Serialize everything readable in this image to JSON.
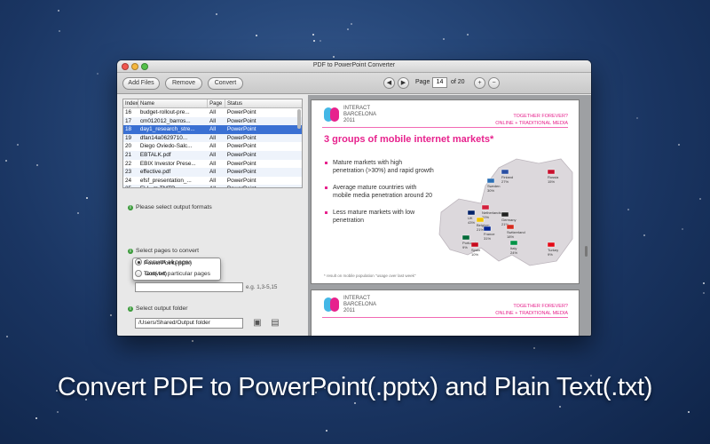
{
  "window": {
    "title": "PDF to PowerPoint Converter"
  },
  "toolbar": {
    "add_files": "Add Files",
    "remove": "Remove",
    "convert": "Convert",
    "page_label": "Page",
    "page_value": "14",
    "page_total": "of 20",
    "prev": "◀",
    "next": "▶",
    "zoom_in": "+",
    "zoom_out": "−"
  },
  "file_table": {
    "columns": [
      "Index",
      "Name",
      "Page",
      "Status"
    ],
    "rows": [
      {
        "index": "16",
        "name": "budget-rollout-pre...",
        "page": "All",
        "status": "PowerPoint"
      },
      {
        "index": "17",
        "name": "cm012012_barros...",
        "page": "All",
        "status": "PowerPoint"
      },
      {
        "index": "18",
        "name": "day1_research_stre...",
        "page": "All",
        "status": "PowerPoint"
      },
      {
        "index": "19",
        "name": "dfan14a0629710...",
        "page": "All",
        "status": "PowerPoint"
      },
      {
        "index": "20",
        "name": "Diego Oviedo-Salc...",
        "page": "All",
        "status": "PowerPoint"
      },
      {
        "index": "21",
        "name": "EBTALK.pdf",
        "page": "All",
        "status": "PowerPoint"
      },
      {
        "index": "22",
        "name": "EBIX Investor Prese...",
        "page": "All",
        "status": "PowerPoint"
      },
      {
        "index": "23",
        "name": "effective.pdf",
        "page": "All",
        "status": "PowerPoint"
      },
      {
        "index": "24",
        "name": "efsf_presentation_...",
        "page": "All",
        "status": "PowerPoint"
      },
      {
        "index": "25",
        "name": "El-L. m.TMTP",
        "page": "All",
        "status": "PowerPoint"
      }
    ],
    "selected_index": 2
  },
  "output_format": {
    "label": "Please select output formats",
    "options": [
      "PowerPoint(.pptx)",
      "Text(.txt)"
    ],
    "selected": "PowerPoint(.pptx)"
  },
  "pages": {
    "label": "Select pages to convert",
    "option_all": "Convert all pages",
    "option_particular": "Convert particular pages",
    "range_value": "",
    "hint": "e.g. 1,3-5,15"
  },
  "output_folder": {
    "label": "Select output folder",
    "path": "/Users/Shared/Output folder"
  },
  "preview": {
    "brand_line1": "INTERACT",
    "brand_line2": "BARCELONA",
    "brand_line3": "2011",
    "tagline1": "TOGETHER FOREVER?",
    "tagline2": "ONLINE + TRADITIONAL MEDIA",
    "heading": "3 groups of mobile internet markets*",
    "bullets": [
      "Mature markets with high penetration (>30%) and rapid growth",
      "Average mature countries with mobile media penetration around 20",
      "Less mature markets with low penetration"
    ],
    "footnote": "* result on mobile population \"usage over last week\"",
    "countries": [
      {
        "name": "Finland",
        "value": "27%"
      },
      {
        "name": "Russia",
        "value": "15%"
      },
      {
        "name": "Sweden",
        "value": "30%"
      },
      {
        "name": "Netherlands",
        "value": "20%"
      },
      {
        "name": "UK",
        "value": "43%"
      },
      {
        "name": "Belgium",
        "value": "21%"
      },
      {
        "name": "Germany",
        "value": "21%"
      },
      {
        "name": "France",
        "value": "31%"
      },
      {
        "name": "Switzerland",
        "value": "18%"
      },
      {
        "name": "Portugal",
        "value": "9%"
      },
      {
        "name": "Spain",
        "value": "10%"
      },
      {
        "name": "Italy",
        "value": "24%"
      },
      {
        "name": "Turkey",
        "value": "9%"
      }
    ]
  },
  "caption": "Convert PDF to PowerPoint(.pptx) and Plain Text(.txt)"
}
